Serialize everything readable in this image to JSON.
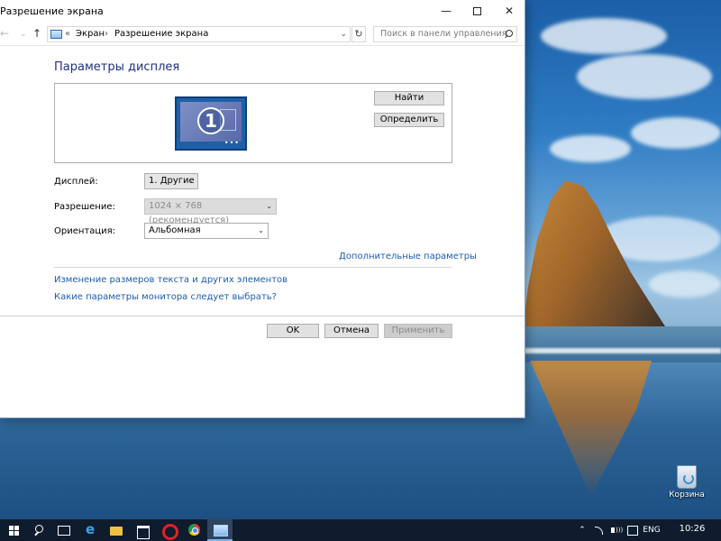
{
  "window": {
    "title": "Разрешение экрана",
    "controls": {
      "minimize": "—",
      "close": "✕"
    }
  },
  "address": {
    "lead": "«",
    "crumbs": [
      "Экран",
      "Разрешение экрана"
    ],
    "separator": "›",
    "search_placeholder": "Поиск в панели управления"
  },
  "content": {
    "heading": "Параметры дисплея",
    "monitor_number": "1",
    "buttons": {
      "find": "Найти",
      "detect": "Определить"
    },
    "fields": {
      "display": {
        "label": "Дисплей:",
        "value": "1. Другие"
      },
      "resolution": {
        "label": "Разрешение:",
        "value": "1024 × 768 (рекомендуется)"
      },
      "orientation": {
        "label": "Ориентация:",
        "value": "Альбомная"
      }
    },
    "advanced_link": "Дополнительные параметры",
    "links": [
      "Изменение размеров текста и других элементов",
      "Какие параметры монитора следует выбрать?"
    ],
    "dialog_buttons": {
      "ok": "OK",
      "cancel": "Отмена",
      "apply": "Применить"
    }
  },
  "desktop": {
    "recycle_bin_label": "Корзина"
  },
  "taskbar": {
    "apps": [
      "start",
      "search",
      "task-view",
      "edge",
      "file-explorer",
      "store",
      "opera",
      "chrome",
      "control-panel"
    ],
    "active_app": "control-panel",
    "language": "ENG",
    "time": "10:26"
  },
  "colors": {
    "link": "#1a5cb3",
    "heading": "#1e3287",
    "taskbar": "#0f1c2e"
  }
}
